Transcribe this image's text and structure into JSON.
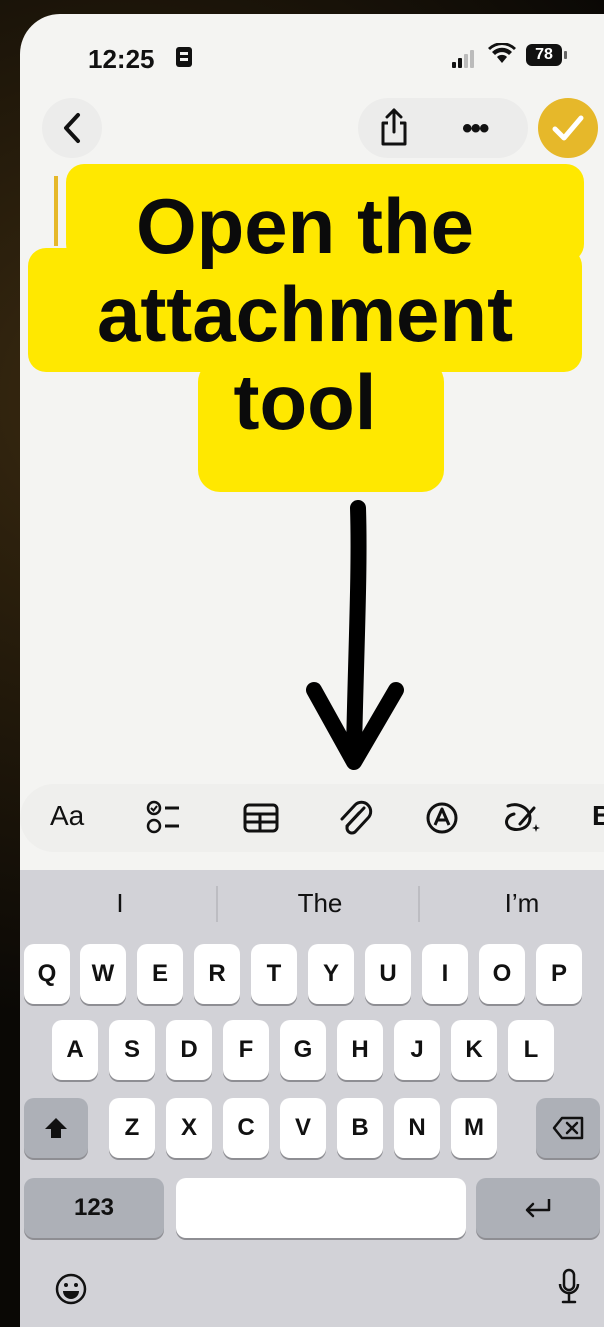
{
  "status_bar": {
    "time": "12:25",
    "battery": "78"
  },
  "callout": {
    "line1": "Open the",
    "line2": "attachment",
    "line3": "tool"
  },
  "toolbar": {
    "text_style_label": "Aa",
    "overflow_label": "B"
  },
  "suggestions": [
    "I",
    "The",
    "I’m"
  ],
  "keyboard": {
    "row1": [
      "Q",
      "W",
      "E",
      "R",
      "T",
      "Y",
      "U",
      "I",
      "O",
      "P"
    ],
    "row2": [
      "A",
      "S",
      "D",
      "F",
      "G",
      "H",
      "J",
      "K",
      "L"
    ],
    "row3": [
      "Z",
      "X",
      "C",
      "V",
      "B",
      "N",
      "M"
    ],
    "numbers_label": "123"
  },
  "icons": {
    "back": "chevron-left-icon",
    "share": "share-icon",
    "more": "ellipsis-icon",
    "done": "checkmark-icon",
    "checklist": "checklist-icon",
    "table": "table-icon",
    "attachment": "paperclip-icon",
    "markup": "pen-circle-icon",
    "ai": "sparkle-pen-icon",
    "shift": "shift-icon",
    "delete": "delete-icon",
    "return": "return-icon",
    "emoji": "emoji-icon",
    "mic": "microphone-icon"
  },
  "colors": {
    "accent": "#e6b82a",
    "callout": "#ffe800",
    "keyboard_bg": "#d2d2d7"
  }
}
